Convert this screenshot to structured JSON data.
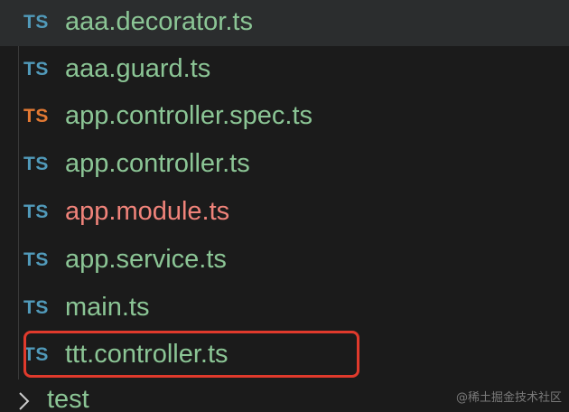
{
  "explorer": {
    "files": [
      {
        "icon": "TS",
        "icon_name": "typescript-icon",
        "name": "aaa.decorator.ts",
        "status": "clean",
        "selected": true
      },
      {
        "icon": "TS",
        "icon_name": "typescript-icon",
        "name": "aaa.guard.ts",
        "status": "clean"
      },
      {
        "icon": "TS",
        "icon_name": "typescript-test-icon",
        "name": "app.controller.spec.ts",
        "status": "clean"
      },
      {
        "icon": "TS",
        "icon_name": "typescript-icon",
        "name": "app.controller.ts",
        "status": "clean"
      },
      {
        "icon": "TS",
        "icon_name": "typescript-icon",
        "name": "app.module.ts",
        "status": "error"
      },
      {
        "icon": "TS",
        "icon_name": "typescript-icon",
        "name": "app.service.ts",
        "status": "clean"
      },
      {
        "icon": "TS",
        "icon_name": "typescript-icon",
        "name": "main.ts",
        "status": "clean"
      },
      {
        "icon": "TS",
        "icon_name": "typescript-icon",
        "name": "ttt.controller.ts",
        "status": "clean",
        "highlighted": true
      }
    ],
    "folder": {
      "name": "test",
      "icon_name": "chevron-right-icon",
      "expanded": false
    }
  },
  "colors": {
    "background": "#1b1b1b",
    "ts_icon": "#519aba",
    "ts_test_icon": "#e37933",
    "clean_text": "#8bc595",
    "error_text": "#f0837a",
    "highlight_border": "#e03a2c"
  },
  "watermark": "@稀土掘金技术社区"
}
